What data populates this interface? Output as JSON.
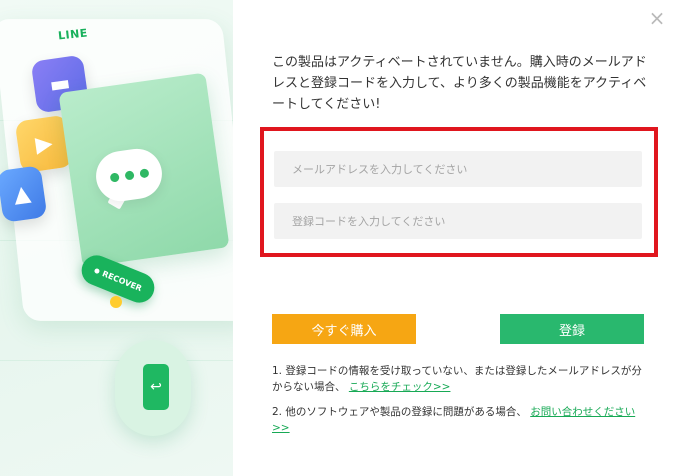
{
  "banner": {
    "line_logo": "LINE",
    "recover_label": "RECOVER"
  },
  "dialog": {
    "intro_text": "この製品はアクティベートされていません。購入時のメールアドレスと登録コードを入力して、より多くの製品機能をアクティベートしてください!",
    "email_placeholder": "メールアドレスを入力してください",
    "code_placeholder": "登録コードを入力してください",
    "buy_label": "今すぐ購入",
    "register_label": "登録",
    "note1_text": "1. 登録コードの情報を受け取っていない、または登録したメールアドレスが分からない場合、",
    "note1_link": "こちらをチェック>>",
    "note2_text": "2. 他のソフトウェアや製品の登録に問題がある場合、",
    "note2_link": "お問い合わせください>>",
    "close_symbol": "×"
  },
  "icons": {
    "close": "close-icon",
    "folder": "folder-icon",
    "video": "video-icon",
    "image": "image-icon",
    "chat": "chat-bubble-icon",
    "phone": "phone-icon"
  },
  "colors": {
    "buy": "#f6a613",
    "register": "#29b86e",
    "link": "#17a955",
    "highlight": "#e0161e",
    "brand_green": "#19b35c"
  }
}
